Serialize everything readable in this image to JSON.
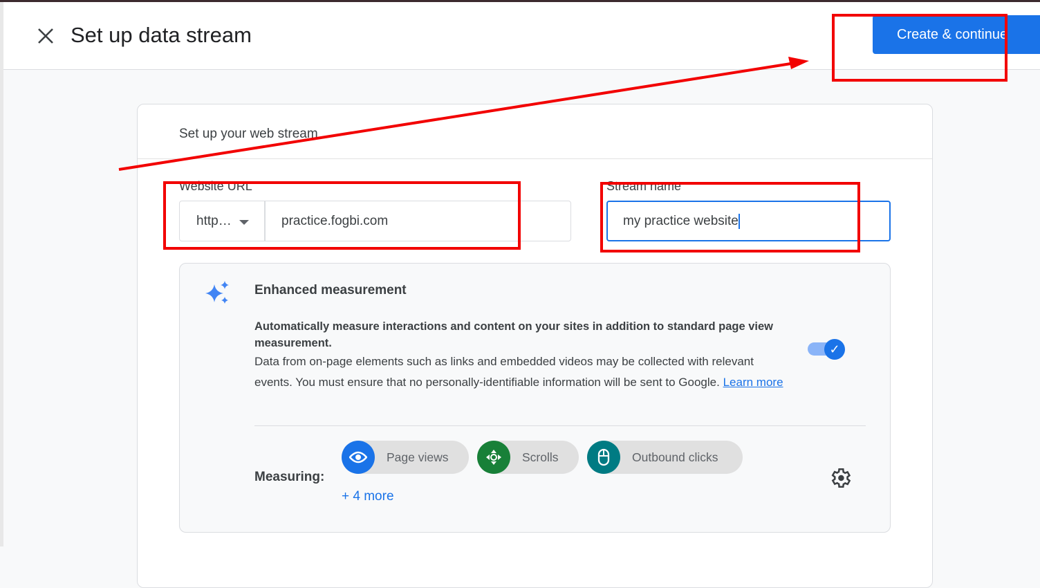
{
  "header": {
    "title": "Set up data stream",
    "create_label": "Create & continue"
  },
  "card": {
    "title": "Set up your web stream",
    "website_url_label": "Website URL",
    "protocol_value": "http…",
    "url_value": "practice.fogbi.com",
    "stream_name_label": "Stream name",
    "stream_name_value": "my practice website"
  },
  "enhanced": {
    "title": "Enhanced measurement",
    "bold_text": "Automatically measure interactions and content on your sites in addition to standard page view measurement.",
    "text": "Data from on-page elements such as links and embedded videos may be collected with relevant events. You must ensure that no personally-identifiable information will be sent to Google.",
    "learn_more": "Learn more",
    "toggle_on": true,
    "measuring_label": "Measuring:",
    "chips": [
      {
        "label": "Page views",
        "icon": "eye-icon",
        "color": "#1a73e8"
      },
      {
        "label": "Scrolls",
        "icon": "scroll-icon",
        "color": "#188038"
      },
      {
        "label": "Outbound clicks",
        "icon": "mouse-icon",
        "color": "#007b83"
      }
    ],
    "more_label": "+ 4 more"
  },
  "colors": {
    "accent": "#1a73e8",
    "annotation": "#f20000"
  }
}
